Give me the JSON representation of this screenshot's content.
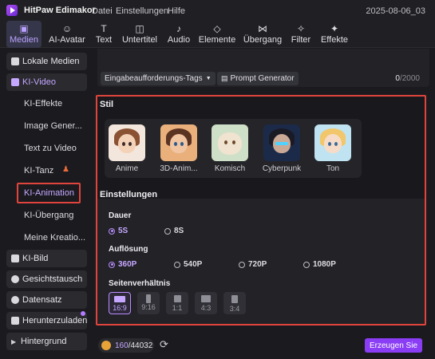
{
  "app": {
    "title": "HitPaw Edimakor",
    "project_name": "2025-08-06_03"
  },
  "menu": [
    "Datei",
    "Einstellungen",
    "Hilfe"
  ],
  "toolbar": {
    "tabs": [
      {
        "label": "Medien",
        "icon": "media-icon",
        "active": true
      },
      {
        "label": "AI-Avatar",
        "icon": "ai-avatar-icon"
      },
      {
        "label": "Text",
        "icon": "text-icon"
      },
      {
        "label": "Untertitel",
        "icon": "subtitle-icon"
      },
      {
        "label": "Audio",
        "icon": "audio-icon"
      },
      {
        "label": "Elemente",
        "icon": "elements-icon"
      },
      {
        "label": "Übergang",
        "icon": "transition-icon"
      },
      {
        "label": "Filter",
        "icon": "filter-icon"
      },
      {
        "label": "Effekte",
        "icon": "effects-icon"
      }
    ]
  },
  "sidebar": {
    "categories": [
      {
        "label": "Lokale Medien"
      },
      {
        "label": "KI-Video"
      },
      {
        "label": "KI-Bild"
      },
      {
        "label": "Gesichtstausch"
      },
      {
        "label": "Datensatz"
      },
      {
        "label": "Herunterzuladen"
      },
      {
        "label": "Hintergrund"
      }
    ],
    "ki_video_items": [
      "KI-Effekte",
      "Image Gener...",
      "Text zu Video",
      "KI-Tanz",
      "KI-Animation",
      "KI-Übergang",
      "Meine Kreatio..."
    ],
    "selected": "KI-Animation"
  },
  "prompt": {
    "tags_button": "Eingabeaufforderungs-Tags",
    "generator_button": "Prompt Generator",
    "char_count": "0",
    "char_limit": "/2000"
  },
  "style": {
    "title": "Stil",
    "items": [
      "Anime",
      "3D-Anim...",
      "Komisch",
      "Cyberpunk",
      "Ton"
    ]
  },
  "settings": {
    "title": "Einstellungen",
    "duration": {
      "label": "Dauer",
      "options": [
        "5S",
        "8S"
      ],
      "selected": "5S"
    },
    "resolution": {
      "label": "Auflösung",
      "options": [
        "360P",
        "540P",
        "720P",
        "1080P"
      ],
      "selected": "360P"
    },
    "aspect": {
      "label": "Seitenverhältnis",
      "options": [
        "16:9",
        "9:16",
        "1:1",
        "4:3",
        "3:4"
      ],
      "selected": "16:9"
    }
  },
  "footer": {
    "credits_used": "160",
    "credits_total": "/44032",
    "generate_button": "Erzeugen Sie"
  },
  "colors": {
    "accent": "#8a3df5",
    "accent_text": "#c5a7ff",
    "highlight": "#e0443c"
  }
}
